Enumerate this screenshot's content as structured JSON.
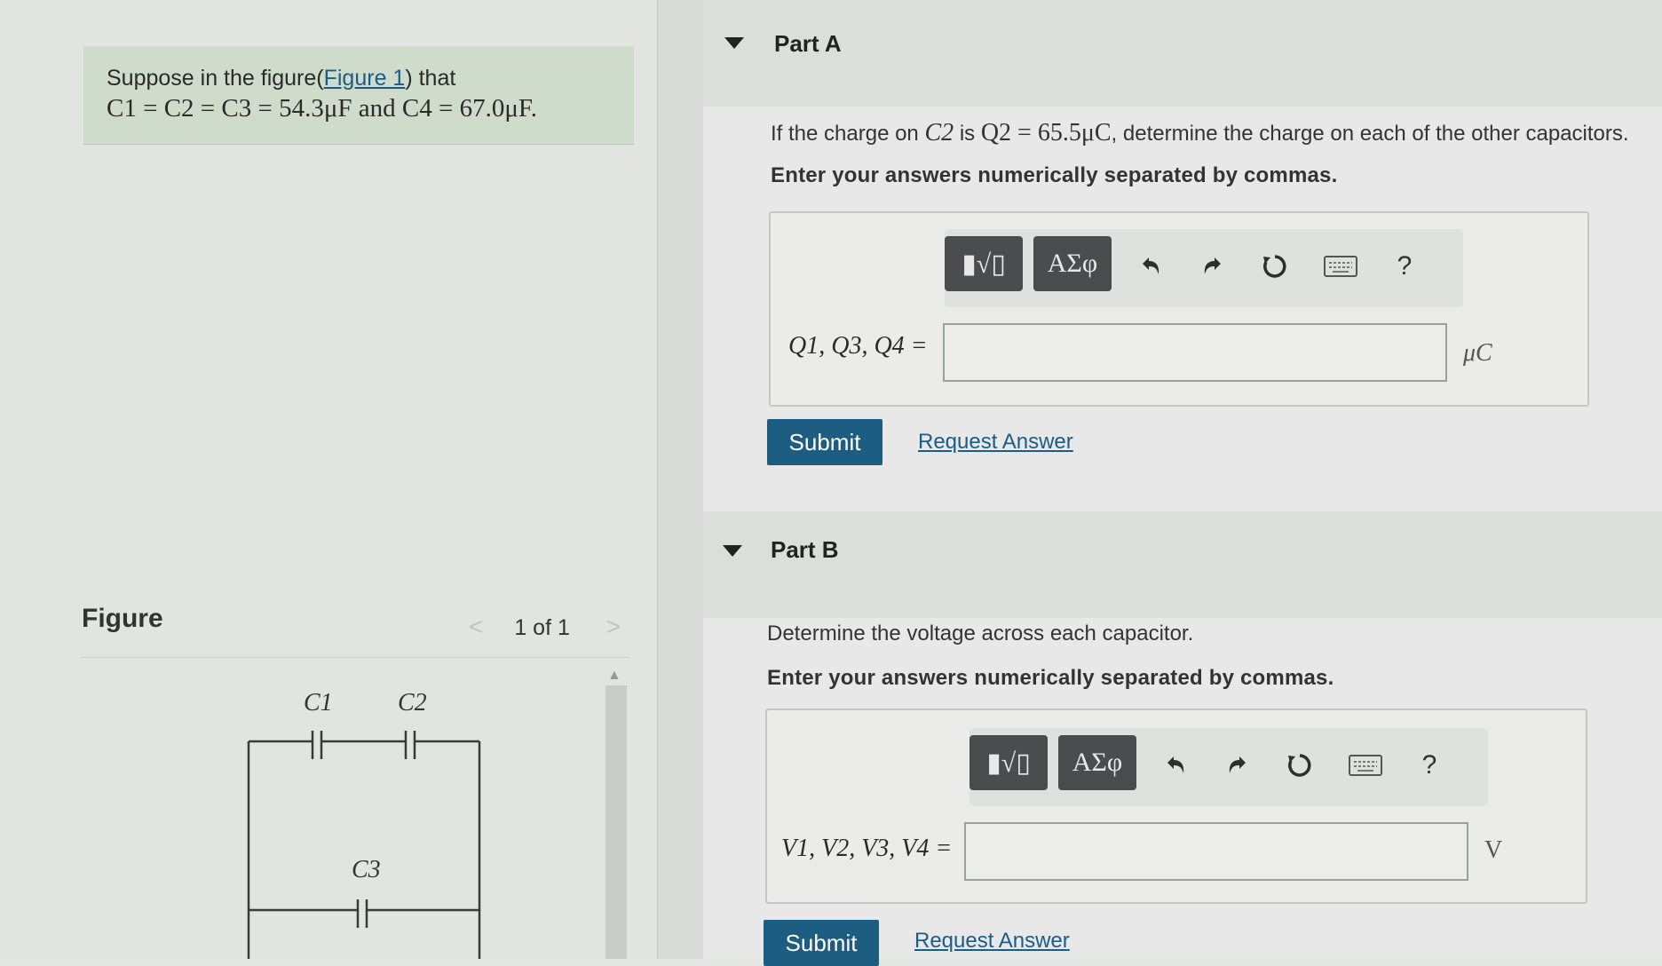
{
  "problem": {
    "intro": "Suppose in the figure(",
    "figure_link": "Figure 1",
    "intro_end": ") that",
    "equation": "C1 = C2 = C3 = 54.3μF and C4 = 67.0μF."
  },
  "figure": {
    "heading": "Figure",
    "nav_prev": "<",
    "nav_text": "1 of 1",
    "nav_next": ">",
    "labels": {
      "c1": "C1",
      "c2": "C2",
      "c3": "C3"
    }
  },
  "partA": {
    "title": "Part A",
    "question_prefix": "If the charge on",
    "question_var": "C2",
    "question_mid": "is",
    "question_value": "Q2 = 65.5μC",
    "question_suffix": ", determine the charge on each of the other capacitors.",
    "instruction": "Enter your answers numerically separated by commas.",
    "input_label": "Q1, Q3, Q4 =",
    "input_value": "",
    "unit": "μC",
    "submit_label": "Submit",
    "request_label": "Request Answer"
  },
  "partB": {
    "title": "Part B",
    "question": "Determine the voltage across each capacitor.",
    "instruction": "Enter your answers numerically separated by commas.",
    "input_label": "V1, V2, V3, V4 =",
    "input_value": "",
    "unit": "V",
    "submit_label": "Submit",
    "request_label": "Request Answer"
  },
  "toolbar": {
    "template_label": "▮√▯",
    "greek_label": "ΑΣφ",
    "undo_icon": "undo-icon",
    "redo_icon": "redo-icon",
    "reset_icon": "reset-icon",
    "keyboard_icon": "keyboard-icon",
    "help_label": "?"
  },
  "colors": {
    "submit_bg": "#1e5d82",
    "link": "#1a5c8a",
    "problem_bg": "#cfdccc"
  }
}
